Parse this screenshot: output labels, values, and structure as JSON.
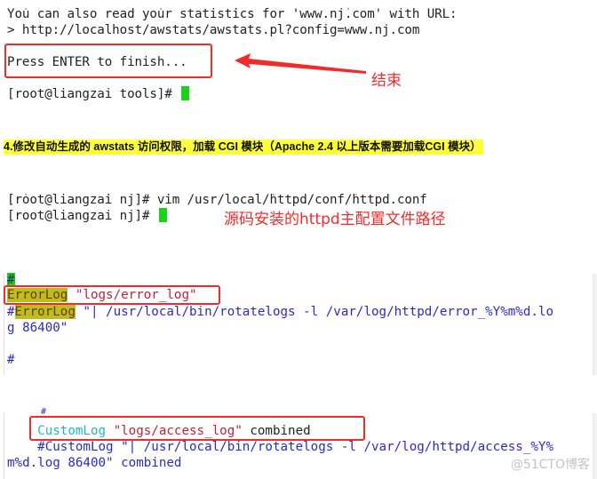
{
  "terminal_top": {
    "lines": [
      "You can also read your statistics for 'www.nj.com' with URL:",
      "> http://localhost/awstats/awstats.pl?config=www.nj.com",
      "Press ENTER to finish...",
      "[root@liangzai tools]# "
    ],
    "annotation": "结束"
  },
  "step_heading": "4.修改自动生成的 awstats 访问权限，加载 CGI 模块（Apache 2.4 以上版本需要加载CGI 模块）",
  "terminal_mid": {
    "lines": [
      "[root@liangzai nj]# vim /usr/local/httpd/conf/httpd.conf",
      "[root@liangzai nj]# "
    ],
    "annotation": "源码安装的httpd主配置文件路径"
  },
  "config_error": {
    "hash_line": "#",
    "errorlog_keyword": "ErrorLog",
    "errorlog_value": "\"logs/error_log\"",
    "comment_prefix": "#",
    "comment_keyword": "ErrorLog",
    "comment_rest": " \"| /usr/local/bin/rotatelogs -l /var/log/httpd/error_%Y%m%d.lo",
    "comment_wrap": "g 86400\"",
    "trailing_hash": "#"
  },
  "config_custom": {
    "hash_line": "#",
    "customlog_keyword": "CustomLog",
    "customlog_value": "\"logs/access_log\"",
    "customlog_format": " combined",
    "comment_line": "    #CustomLog \"| /usr/local/bin/rotatelogs -l /var/log/httpd/access_%Y%",
    "comment_wrap": "m%d.log 86400\" combined"
  },
  "watermark": "@51CTO博客",
  "colors": {
    "annotation_red": "#f42a2a",
    "cursor_green": "#1bd21b",
    "heading_highlight": "#ffff33",
    "vim_keyword_highlight": "#bdbd1d",
    "vim_string": "#c21f3a",
    "vim_comment_blue": "#2a2acc",
    "vim_cyan": "#1fb8c8"
  }
}
